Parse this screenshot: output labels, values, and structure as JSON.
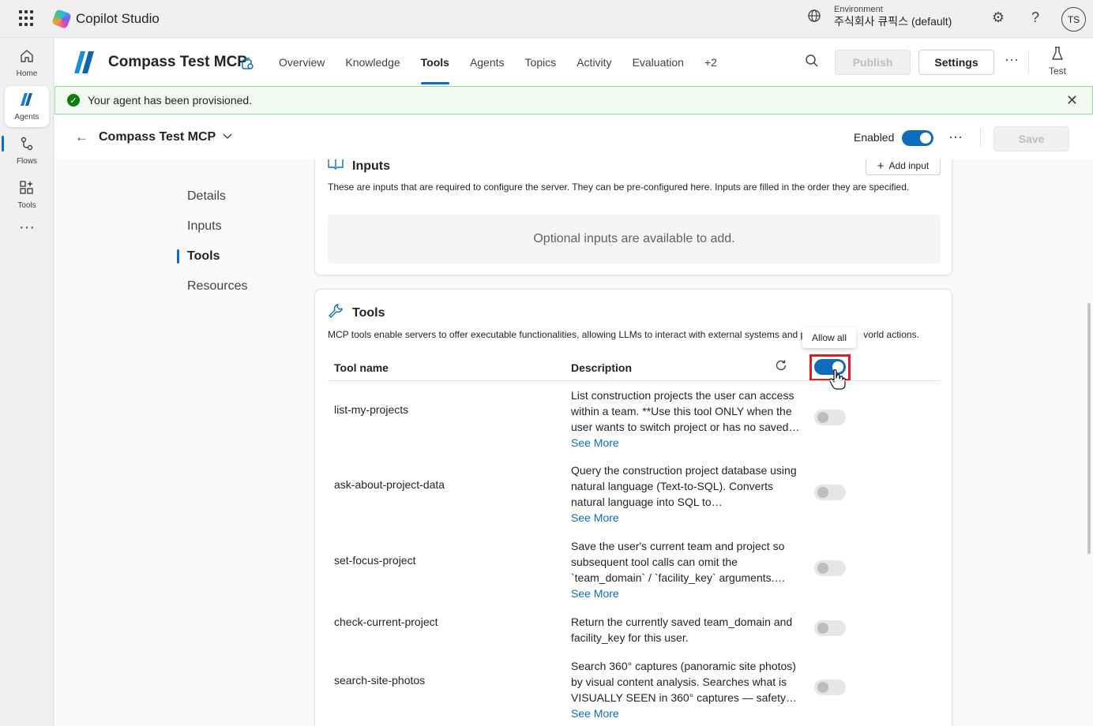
{
  "topbar": {
    "app_name": "Copilot Studio",
    "environment_label": "Environment",
    "environment_value": "주식회사 큐픽스 (default)",
    "avatar_initials": "TS"
  },
  "rail": {
    "items": [
      {
        "label": "Home",
        "icon": "home-icon"
      },
      {
        "label": "Agents",
        "icon": "agents-icon"
      },
      {
        "label": "Flows",
        "icon": "flows-icon"
      },
      {
        "label": "Tools",
        "icon": "tools-icon"
      }
    ]
  },
  "header": {
    "agent_name": "Compass Test MCP",
    "tabs": [
      {
        "label": "Overview"
      },
      {
        "label": "Knowledge"
      },
      {
        "label": "Tools",
        "active": true
      },
      {
        "label": "Agents"
      },
      {
        "label": "Topics"
      },
      {
        "label": "Activity"
      },
      {
        "label": "Evaluation"
      },
      {
        "label": "+2"
      }
    ],
    "publish_label": "Publish",
    "settings_label": "Settings",
    "test_label": "Test"
  },
  "banner": {
    "message": "Your agent has been provisioned."
  },
  "subheader": {
    "title": "Compass Test MCP",
    "enabled_label": "Enabled",
    "enabled": true,
    "save_label": "Save"
  },
  "side_nav": {
    "items": [
      {
        "label": "Details"
      },
      {
        "label": "Inputs"
      },
      {
        "label": "Tools",
        "active": true
      },
      {
        "label": "Resources"
      }
    ]
  },
  "inputs_section": {
    "title": "Inputs",
    "add_label": "Add input",
    "description": "These are inputs that are required to configure the server. They can be pre-configured here. Inputs are filled in the order they are specified.",
    "empty_text": "Optional inputs are available to add."
  },
  "tools_section": {
    "title": "Tools",
    "description_start": "MCP tools enable servers to offer executable functionalities, allowing LLMs to interact with external systems and p",
    "description_end": "vorld actions.",
    "col_name": "Tool name",
    "col_description": "Description",
    "allow_all_tooltip": "Allow all",
    "allow_all": true,
    "see_more_label": "See More",
    "tools": [
      {
        "name": "list-my-projects",
        "description": "List construction projects the user can access within a team. **Use this tool ONLY when the user wants to switch project or has no saved…",
        "see_more": true,
        "enabled": false
      },
      {
        "name": "ask-about-project-data",
        "description": "Query the construction project database using natural language (Text-to-SQL). Converts natural language into SQL to…",
        "see_more": true,
        "enabled": false
      },
      {
        "name": "set-focus-project",
        "description": "Save the user's current team and project so subsequent tool calls can omit the `team_domain` / `facility_key` arguments.…",
        "see_more": true,
        "enabled": false
      },
      {
        "name": "check-current-project",
        "description": "Return the currently saved team_domain and facility_key for this user.",
        "see_more": false,
        "enabled": false
      },
      {
        "name": "search-site-photos",
        "description": "Search 360° captures (panoramic site photos) by visual content analysis. Searches what is VISUALLY SEEN in 360° captures — safety…",
        "see_more": true,
        "enabled": false
      }
    ]
  }
}
